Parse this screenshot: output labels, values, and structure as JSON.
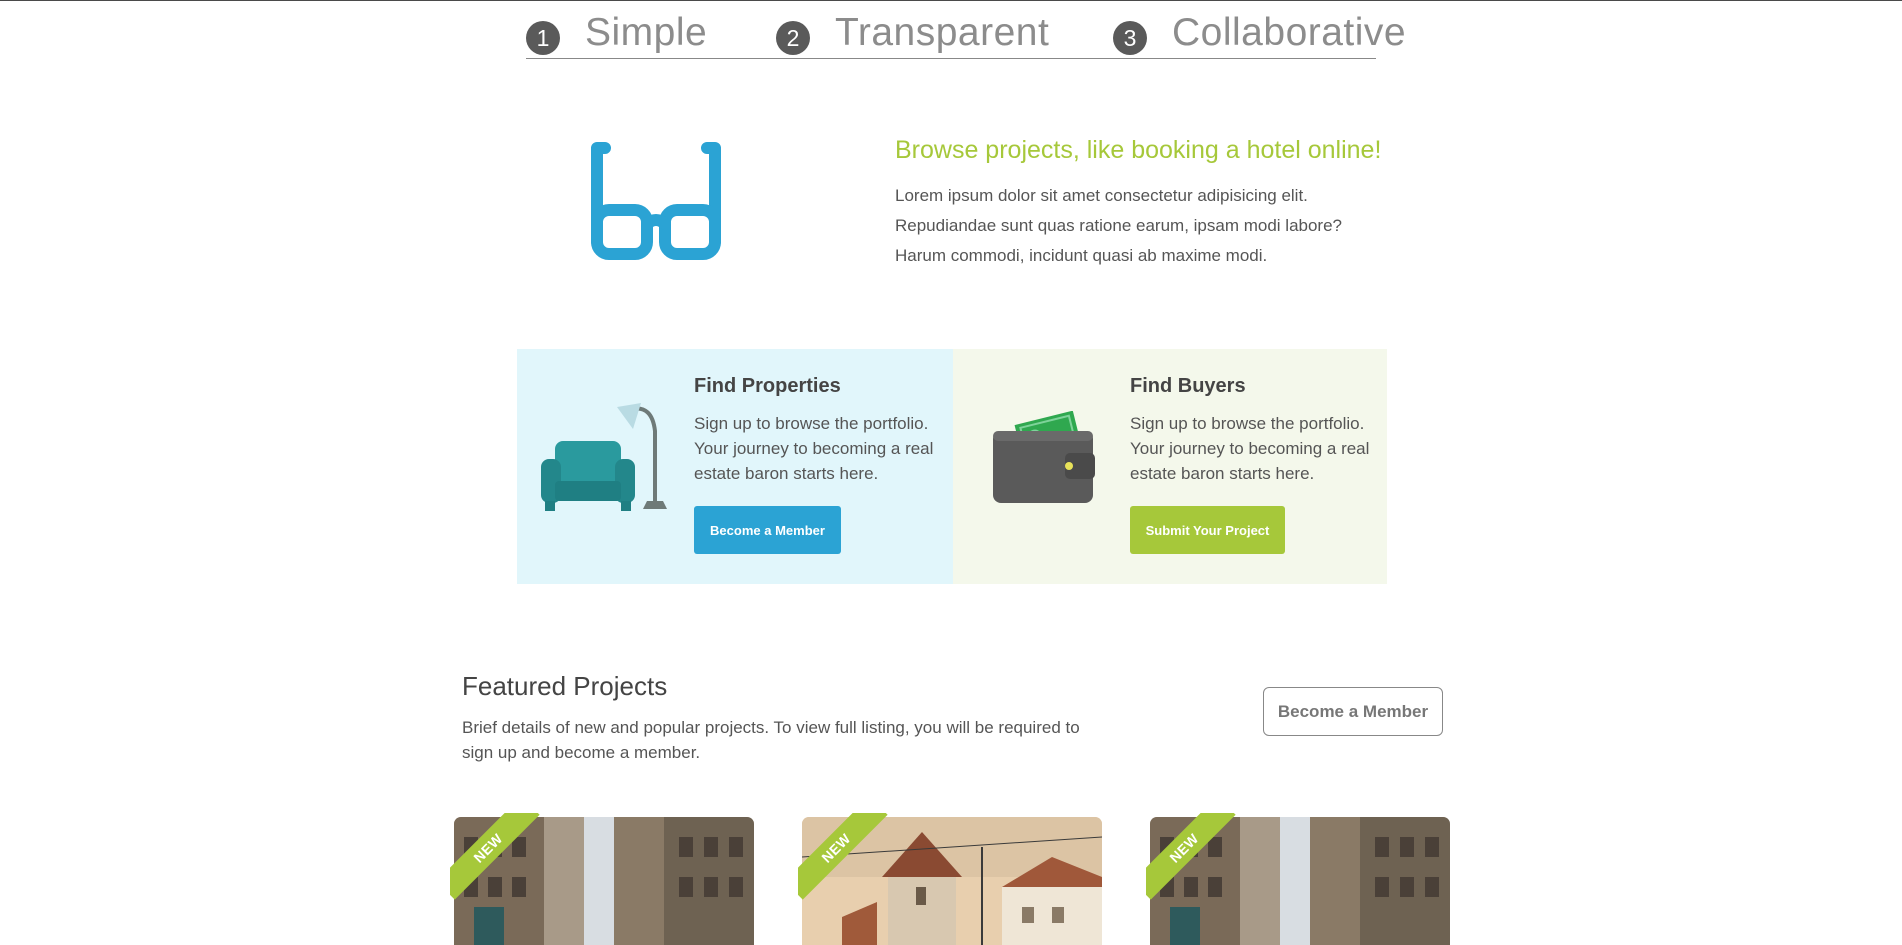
{
  "steps": [
    {
      "number": "1",
      "label": "Simple"
    },
    {
      "number": "2",
      "label": "Transparent"
    },
    {
      "number": "3",
      "label": "Collaborative"
    }
  ],
  "intro": {
    "heading": "Browse projects, like booking a hotel online!",
    "lines": [
      "Lorem ipsum dolor sit amet consectetur adipisicing elit.",
      "Repudiandae sunt quas ratione earum, ipsam modi labore?",
      "Harum commodi, incidunt quasi ab maxime modi."
    ],
    "icon": "glasses-icon"
  },
  "cards": {
    "properties": {
      "title": "Find Properties",
      "lines": [
        "Sign up to browse the portfolio.",
        "Your journey to becoming a real",
        "estate baron starts here."
      ],
      "button": "Become a Member",
      "icon": "armchair-lamp-icon"
    },
    "buyers": {
      "title": "Find Buyers",
      "lines": [
        "Sign up to browse the portfolio.",
        "Your journey to becoming a real",
        "estate baron starts here."
      ],
      "button": "Submit Your Project",
      "icon": "wallet-icon"
    }
  },
  "featured": {
    "title": "Featured Projects",
    "description": "Brief details of new and popular projects. To view full listing, you will be required to sign up and become a member.",
    "button": "Become a Member"
  },
  "projects": [
    {
      "badge": "NEW",
      "image": "city-street-photo"
    },
    {
      "badge": "NEW",
      "image": "church-tower-photo"
    },
    {
      "badge": "NEW",
      "image": "city-street-photo"
    }
  ],
  "colors": {
    "accent_green": "#a6c83a",
    "accent_blue": "#2ba3d4",
    "card_blue_bg": "#e1f6fb",
    "card_green_bg": "#f4f8eb"
  }
}
